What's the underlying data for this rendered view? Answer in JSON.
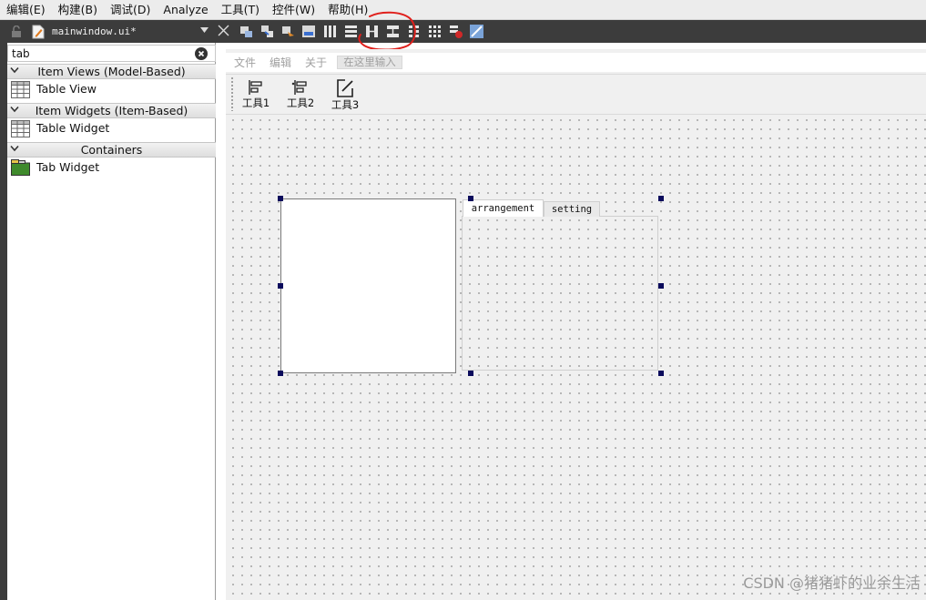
{
  "menubar": {
    "items": [
      "编辑(E)",
      "构建(B)",
      "调试(D)",
      "Analyze",
      "工具(T)",
      "控件(W)",
      "帮助(H)"
    ]
  },
  "document": {
    "filename": "mainwindow.ui*"
  },
  "widget_box": {
    "search_value": "tab",
    "categories": [
      {
        "label": "Item Views (Model-Based)",
        "items": [
          {
            "label": "Table View",
            "icon": "table-icon"
          }
        ]
      },
      {
        "label": "Item Widgets (Item-Based)",
        "items": [
          {
            "label": "Table Widget",
            "icon": "table-icon"
          }
        ]
      },
      {
        "label": "Containers",
        "items": [
          {
            "label": "Tab Widget",
            "icon": "tab-widget-icon"
          }
        ]
      }
    ]
  },
  "form": {
    "menus": [
      "文件",
      "编辑",
      "关于"
    ],
    "type_here": "在这里输入",
    "tools": [
      {
        "label": "工具1",
        "icon": "align-left-icon"
      },
      {
        "label": "工具2",
        "icon": "align-right-icon"
      },
      {
        "label": "工具3",
        "icon": "edit-icon"
      }
    ],
    "tabs": [
      "arrangement",
      "setting"
    ]
  },
  "watermark": "CSDN @猪猪虾的业余生活",
  "colors": {
    "dark_bar": "#3c3c3c",
    "selection_handle": "#0b0b5c",
    "annotation": "#e0201c"
  }
}
